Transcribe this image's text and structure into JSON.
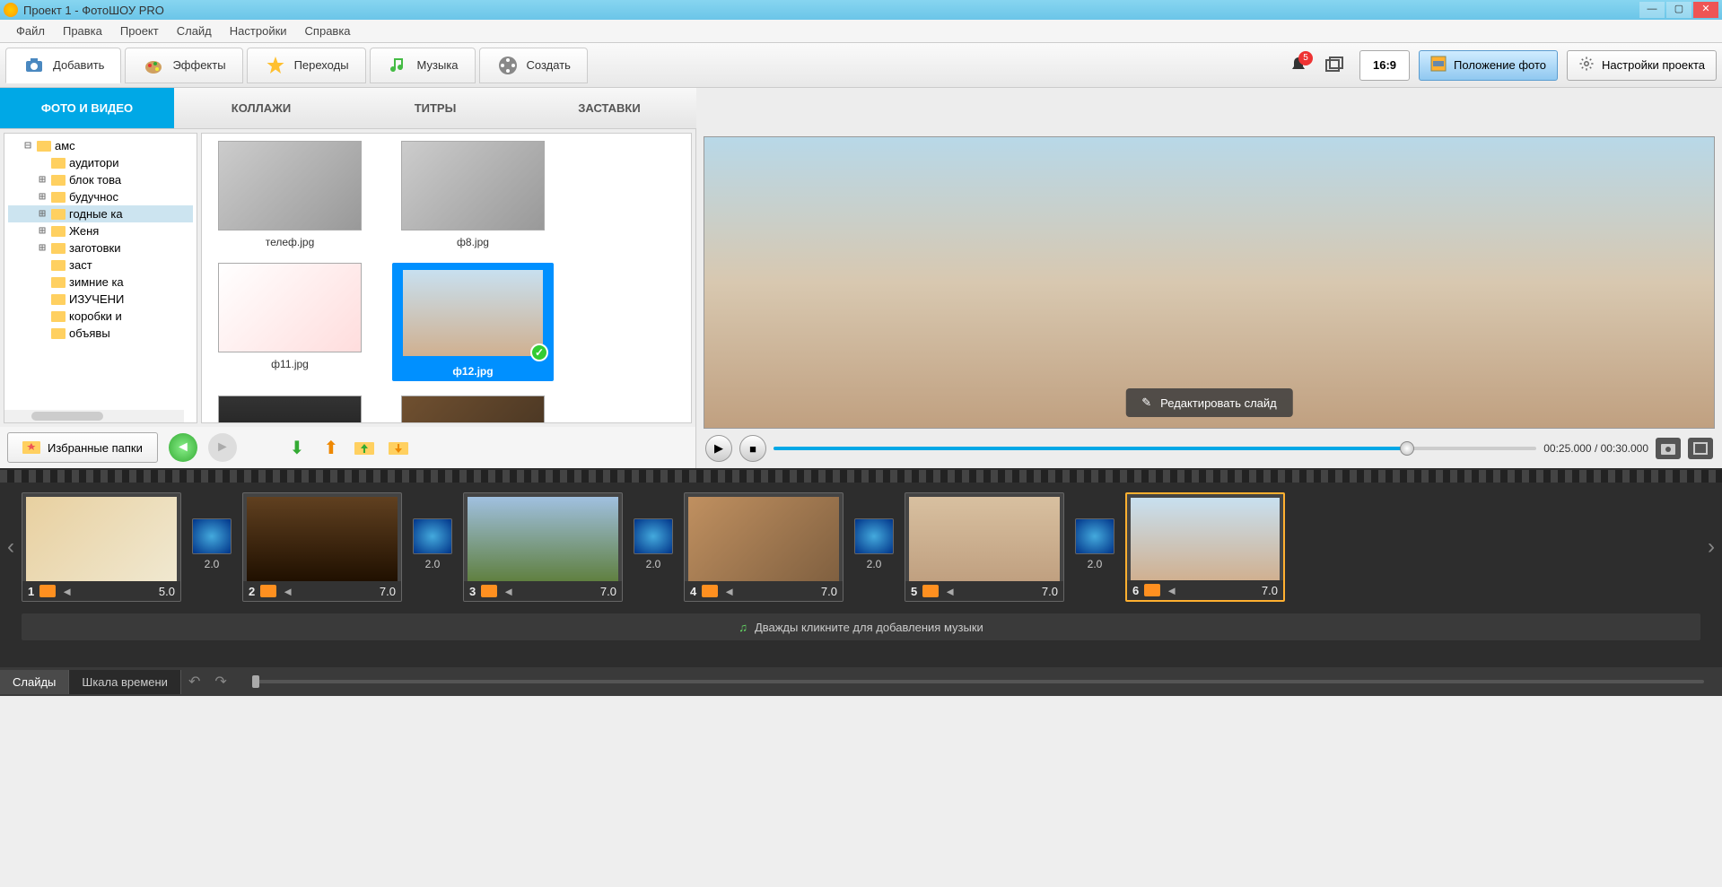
{
  "titlebar": {
    "title": "Проект 1 - ФотоШОУ PRO"
  },
  "menu": {
    "file": "Файл",
    "edit": "Правка",
    "project": "Проект",
    "slide": "Слайд",
    "settings": "Настройки",
    "help": "Справка"
  },
  "toolbar": {
    "add": "Добавить",
    "effects": "Эффекты",
    "transitions": "Переходы",
    "music": "Музыка",
    "create": "Создать",
    "notif_count": "5",
    "ratio": "16:9",
    "photo_pos": "Положение фото",
    "proj_settings": "Настройки проекта"
  },
  "subtabs": {
    "photo_video": "ФОТО И ВИДЕО",
    "collages": "КОЛЛАЖИ",
    "titles": "ТИТРЫ",
    "splash": "ЗАСТАВКИ"
  },
  "tree": [
    {
      "level": 1,
      "label": "амс",
      "exp": "-"
    },
    {
      "level": 2,
      "label": "аудитори"
    },
    {
      "level": 2,
      "label": "блок това",
      "exp": "+"
    },
    {
      "level": 2,
      "label": "будучнос",
      "exp": "+"
    },
    {
      "level": 2,
      "label": "годные ка",
      "exp": "+",
      "selected": true
    },
    {
      "level": 2,
      "label": "Женя",
      "exp": "+"
    },
    {
      "level": 2,
      "label": "заготовки",
      "exp": "+"
    },
    {
      "level": 2,
      "label": "заст"
    },
    {
      "level": 2,
      "label": "зимние ка"
    },
    {
      "level": 2,
      "label": "ИЗУЧЕНИ"
    },
    {
      "level": 2,
      "label": "коробки и"
    },
    {
      "level": 2,
      "label": "объявы"
    }
  ],
  "thumbs": [
    {
      "label": "телеф.jpg",
      "cls": ""
    },
    {
      "label": "ф8.jpg",
      "cls": ""
    },
    {
      "label": "ф11.jpg",
      "cls": "bg-t1"
    },
    {
      "label": "ф12.jpg",
      "selected": true,
      "cls": "bg-t2"
    },
    {
      "label": "",
      "cls": "bg-t3"
    },
    {
      "label": "",
      "cls": "bg-t4"
    }
  ],
  "fav_folders": "Избранные папки",
  "preview": {
    "edit_slide": "Редактировать слайд",
    "time": "00:25.000 / 00:30.000",
    "progress_pct": 83
  },
  "timeline": {
    "slides": [
      {
        "num": "1",
        "dur": "5.0",
        "cls": "g1"
      },
      {
        "num": "2",
        "dur": "7.0",
        "cls": "g2"
      },
      {
        "num": "3",
        "dur": "7.0",
        "cls": "g3"
      },
      {
        "num": "4",
        "dur": "7.0",
        "cls": "g4"
      },
      {
        "num": "5",
        "dur": "7.0",
        "cls": "g5"
      },
      {
        "num": "6",
        "dur": "7.0",
        "cls": "g6",
        "active": true
      }
    ],
    "trans": [
      {
        "dur": "2.0"
      },
      {
        "dur": "2.0"
      },
      {
        "dur": "2.0"
      },
      {
        "dur": "2.0"
      },
      {
        "dur": "2.0"
      }
    ],
    "music_hint": "Дважды кликните для добавления музыки"
  },
  "bottom": {
    "slides": "Слайды",
    "timeline": "Шкала времени"
  }
}
